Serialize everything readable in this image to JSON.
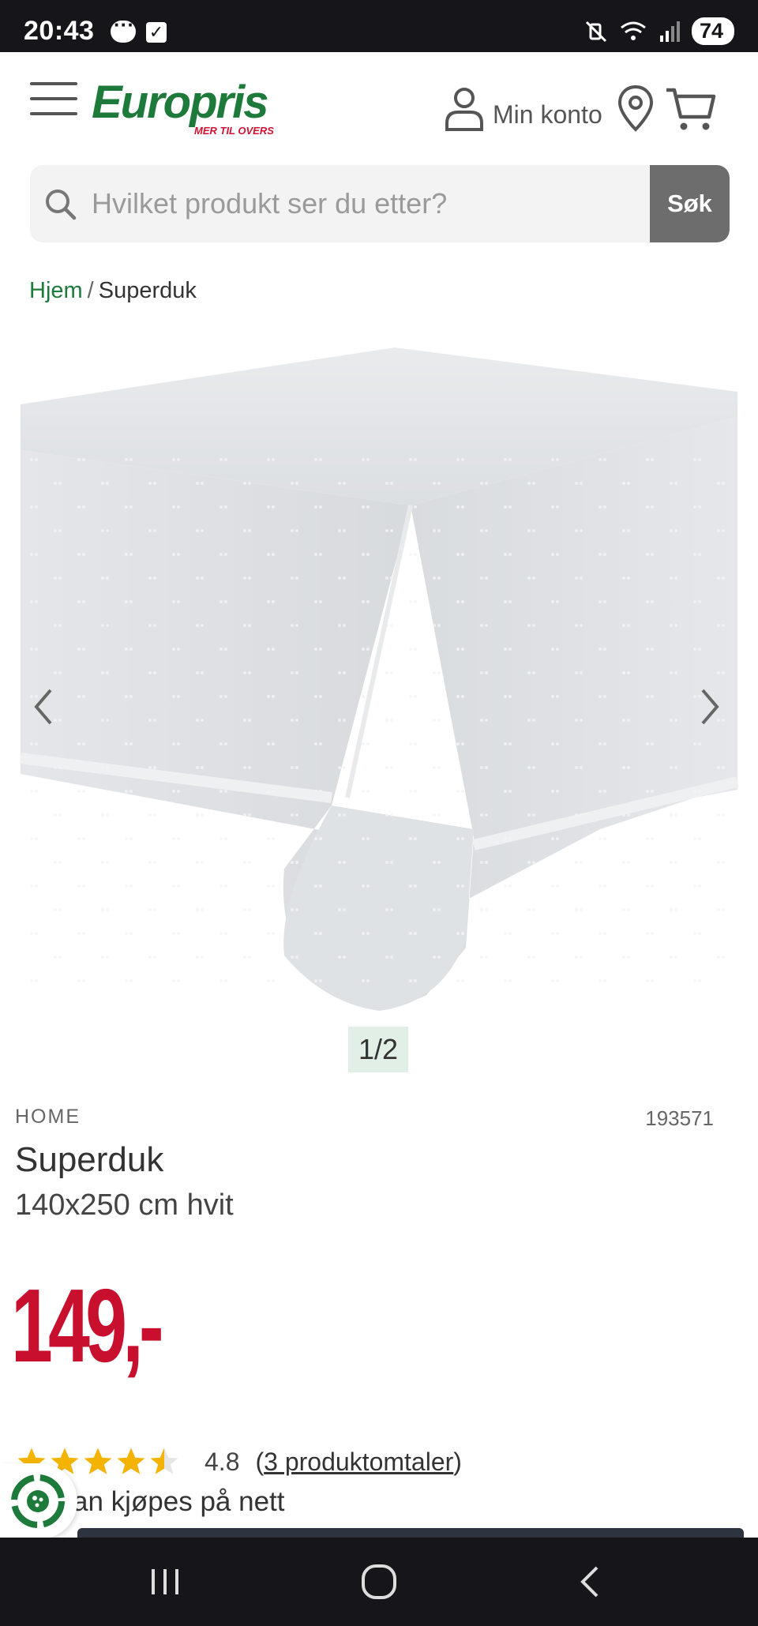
{
  "status_bar": {
    "time": "20:43",
    "battery": "74"
  },
  "header": {
    "logo_text": "Europris",
    "logo_tagline": "MER TIL OVERS",
    "account_label": "Min konto"
  },
  "search": {
    "placeholder": "Hvilket produkt ser du etter?",
    "button_label": "Søk"
  },
  "breadcrumb": {
    "home": "Hjem",
    "separator": "/",
    "current": "Superduk"
  },
  "gallery": {
    "counter": "1/2"
  },
  "product": {
    "brand": "HOME",
    "sku": "193571",
    "title": "Superduk",
    "subtitle": "140x250 cm hvit",
    "price": "149,-",
    "rating_value": "4.8",
    "rating_stars": 4.5,
    "review_open": "(",
    "review_link": "3 produktomtaler",
    "review_close": ")",
    "availability": "an kjøpes på nett"
  },
  "colors": {
    "brand_green": "#1e7a3a",
    "price_red": "#c8102e",
    "star_yellow": "#f5b301"
  }
}
